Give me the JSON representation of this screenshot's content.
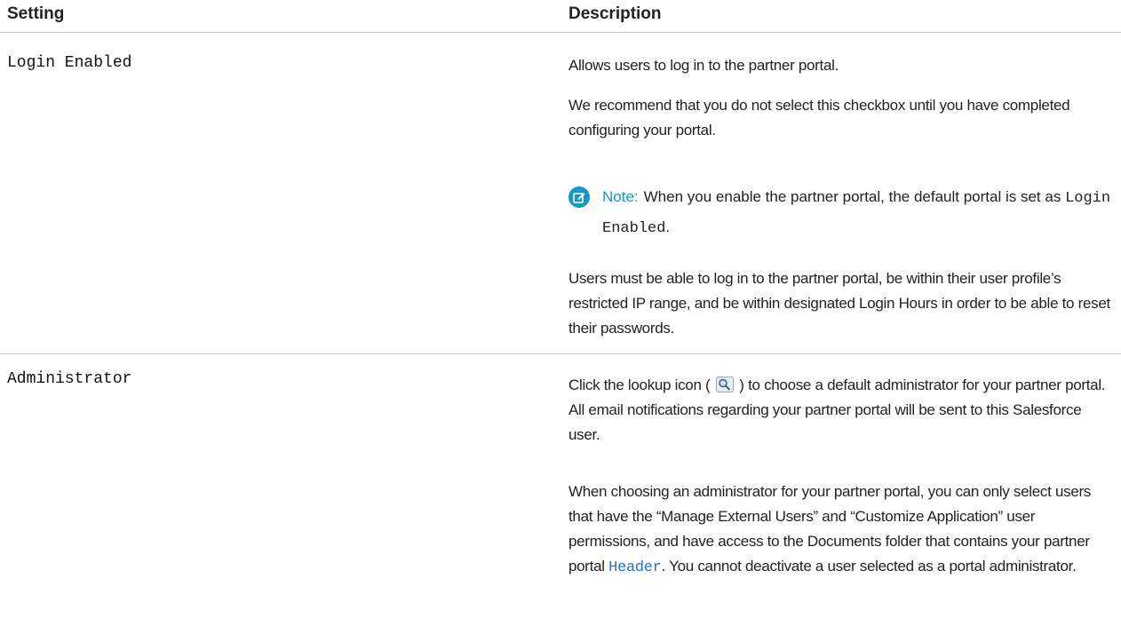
{
  "table": {
    "headers": {
      "setting": "Setting",
      "description": "Description"
    },
    "rows": [
      {
        "setting": "Login Enabled",
        "p1": "Allows users to log in to the partner portal.",
        "p2": "We recommend that you do not select this checkbox until you have completed configuring your portal.",
        "note_label": "Note:",
        "note_text": "When you enable the partner portal, the default portal is set as",
        "note_code": "Login Enabled",
        "note_end": ".",
        "p3": "Users must be able to log in to the partner portal, be within their user profile’s restricted IP range, and be within designated Login Hours in order to be able to reset their passwords."
      },
      {
        "setting": "Administrator",
        "p1_before": "Click the lookup icon (",
        "p1_after": ") to choose a default administrator for your partner portal. All email notifications regarding your partner portal will be sent to this Salesforce user.",
        "p2_before": "When choosing an administrator for your partner portal, you can only select users that have the “Manage External Users” and “Customize Application” user permissions, and have access to the Documents folder that contains your partner portal",
        "p2_link": "Header",
        "p2_after": ". You cannot deactivate a user selected as a portal administrator."
      }
    ]
  },
  "colors": {
    "note_accent": "#1798c1",
    "link": "#2a6fd6",
    "divider": "#c8c8c8"
  },
  "icons": {
    "note": "pencil-note-icon",
    "lookup": "lookup-magnifier-icon"
  }
}
